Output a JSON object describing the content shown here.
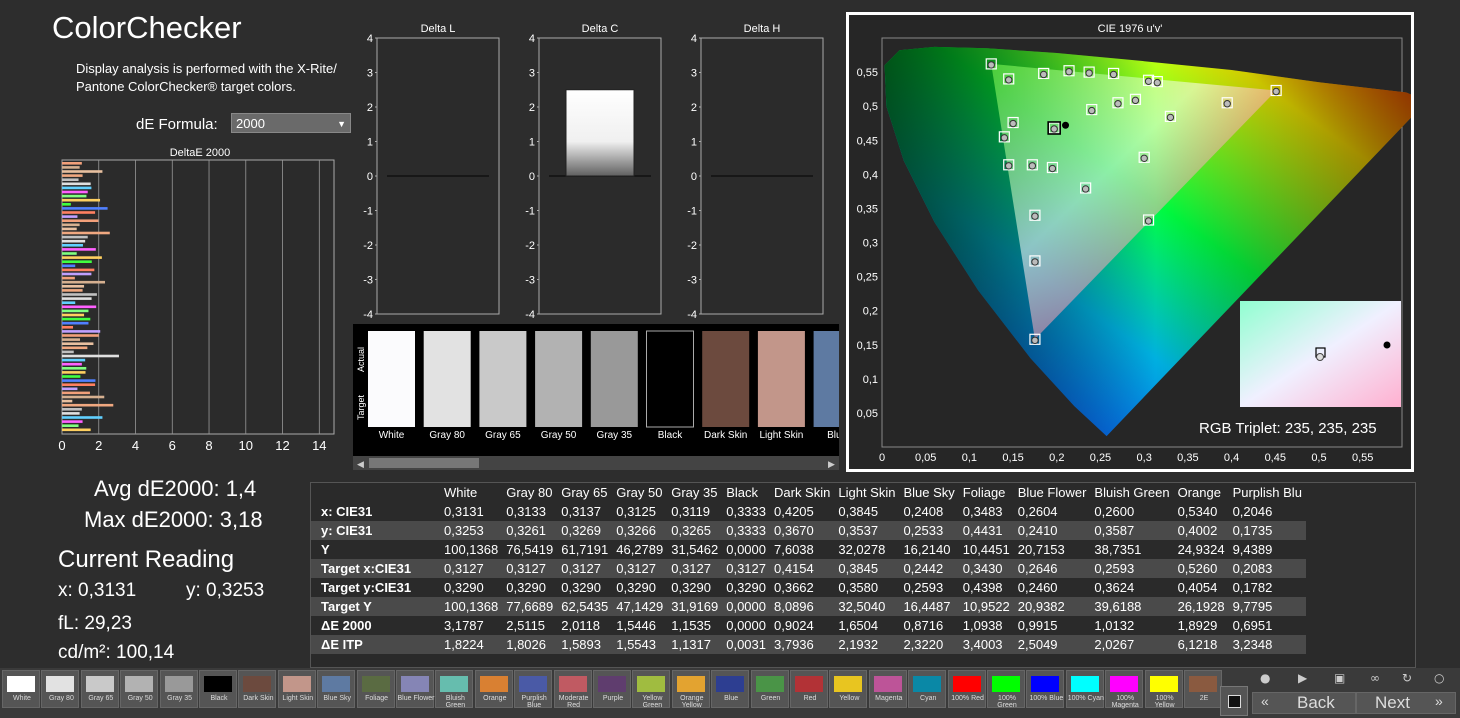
{
  "title": "ColorChecker",
  "description": "Display analysis is performed with the X-Rite/ Pantone ColorChecker® target colors.",
  "formula": {
    "label": "dE Formula:",
    "selected": "2000"
  },
  "deltae_chart": {
    "title": "DeltaE 2000",
    "xticks": [
      "0",
      "2",
      "4",
      "6",
      "8",
      "10",
      "12",
      "14"
    ]
  },
  "delta_charts": [
    {
      "title": "Delta L",
      "yticks": [
        "4",
        "3",
        "2",
        "1",
        "0",
        "-1",
        "-2",
        "-3",
        "-4"
      ],
      "value": 0
    },
    {
      "title": "Delta C",
      "yticks": [
        "4",
        "3",
        "2",
        "1",
        "0",
        "-1",
        "-2",
        "-3",
        "-4"
      ],
      "value": 2.5
    },
    {
      "title": "Delta H",
      "yticks": [
        "4",
        "3",
        "2",
        "1",
        "0",
        "-1",
        "-2",
        "-3",
        "-4"
      ],
      "value": 0
    }
  ],
  "swatch_strip": {
    "actual_label": "Actual",
    "target_label": "Target",
    "swatches": [
      {
        "name": "White",
        "actual": "#fbfbfd",
        "target": "#fbfbfd"
      },
      {
        "name": "Gray 80",
        "actual": "#e2e2e2",
        "target": "#e2e2e2"
      },
      {
        "name": "Gray 65",
        "actual": "#c9c9c9",
        "target": "#c9c9c9"
      },
      {
        "name": "Gray 50",
        "actual": "#b2b2b2",
        "target": "#b2b2b2"
      },
      {
        "name": "Gray 35",
        "actual": "#999999",
        "target": "#999999"
      },
      {
        "name": "Black",
        "actual": "#000000",
        "target": "#000000"
      },
      {
        "name": "Dark Skin",
        "actual": "#6c4a3e",
        "target": "#6c4a3e"
      },
      {
        "name": "Light Skin",
        "actual": "#c2968a",
        "target": "#c2968a"
      },
      {
        "name": "Blue",
        "actual": "#5e7aa2",
        "target": "#5e7aa2"
      }
    ]
  },
  "stats": {
    "avg": "Avg dE2000: 1,4",
    "max": "Max dE2000: 3,18"
  },
  "reading": {
    "title": "Current Reading",
    "x": "x: 0,3131",
    "y": "y: 0,3253",
    "fl": "fL: 29,23",
    "cd": "cd/m²: 100,14"
  },
  "table": {
    "columns": [
      "White",
      "Gray 80",
      "Gray 65",
      "Gray 50",
      "Gray 35",
      "Black",
      "Dark Skin",
      "Light Skin",
      "Blue Sky",
      "Foliage",
      "Blue Flower",
      "Bluish Green",
      "Orange",
      "Purplish Blu"
    ],
    "rows": [
      {
        "label": "x: CIE31",
        "values": [
          "0,3131",
          "0,3133",
          "0,3137",
          "0,3125",
          "0,3119",
          "0,3333",
          "0,4205",
          "0,3845",
          "0,2408",
          "0,3483",
          "0,2604",
          "0,2600",
          "0,5340",
          "0,2046"
        ]
      },
      {
        "label": "y: CIE31",
        "values": [
          "0,3253",
          "0,3261",
          "0,3269",
          "0,3266",
          "0,3265",
          "0,3333",
          "0,3670",
          "0,3537",
          "0,2533",
          "0,4431",
          "0,2410",
          "0,3587",
          "0,4002",
          "0,1735"
        ]
      },
      {
        "label": "Y",
        "values": [
          "100,1368",
          "76,5419",
          "61,7191",
          "46,2789",
          "31,5462",
          "0,0000",
          "7,6038",
          "32,0278",
          "16,2140",
          "10,4451",
          "20,7153",
          "38,7351",
          "24,9324",
          "9,4389"
        ]
      },
      {
        "label": "Target x:CIE31",
        "values": [
          "0,3127",
          "0,3127",
          "0,3127",
          "0,3127",
          "0,3127",
          "0,3127",
          "0,4154",
          "0,3845",
          "0,2442",
          "0,3430",
          "0,2646",
          "0,2593",
          "0,5260",
          "0,2083"
        ]
      },
      {
        "label": "Target y:CIE31",
        "values": [
          "0,3290",
          "0,3290",
          "0,3290",
          "0,3290",
          "0,3290",
          "0,3290",
          "0,3662",
          "0,3580",
          "0,2593",
          "0,4398",
          "0,2460",
          "0,3624",
          "0,4054",
          "0,1782"
        ]
      },
      {
        "label": "Target Y",
        "values": [
          "100,1368",
          "77,6689",
          "62,5435",
          "47,1429",
          "31,9169",
          "0,0000",
          "8,0896",
          "32,5040",
          "16,4487",
          "10,9522",
          "20,9382",
          "39,6188",
          "26,1928",
          "9,7795"
        ]
      },
      {
        "label": "ΔE 2000",
        "values": [
          "3,1787",
          "2,5115",
          "2,0118",
          "1,5446",
          "1,1535",
          "0,0000",
          "0,9024",
          "1,6504",
          "0,8716",
          "1,0938",
          "0,9915",
          "1,0132",
          "1,8929",
          "0,6951"
        ]
      },
      {
        "label": "ΔE ITP",
        "values": [
          "1,8224",
          "1,8026",
          "1,5893",
          "1,5543",
          "1,1317",
          "0,0031",
          "3,7936",
          "2,1932",
          "2,3220",
          "3,4003",
          "2,5049",
          "2,0267",
          "6,1218",
          "3,2348"
        ]
      }
    ]
  },
  "cie": {
    "title": "CIE 1976 u'v'",
    "xticks": [
      "0",
      "0,05",
      "0,1",
      "0,15",
      "0,2",
      "0,25",
      "0,3",
      "0,35",
      "0,4",
      "0,45",
      "0,5",
      "0,55"
    ],
    "yticks": [
      "0,55",
      "0,5",
      "0,45",
      "0,4",
      "0,35",
      "0,3",
      "0,25",
      "0,2",
      "0,15",
      "0,1",
      "0,05"
    ],
    "triplet": "RGB Triplet: 235, 235, 235"
  },
  "chips": [
    {
      "label": "White",
      "color": "#ffffff"
    },
    {
      "label": "Gray 80",
      "color": "#e2e2e2"
    },
    {
      "label": "Gray 65",
      "color": "#c9c9c9"
    },
    {
      "label": "Gray 50",
      "color": "#b2b2b2"
    },
    {
      "label": "Gray 35",
      "color": "#999999"
    },
    {
      "label": "Black",
      "color": "#000000"
    },
    {
      "label": "Dark Skin",
      "color": "#6c4a3e"
    },
    {
      "label": "Light Skin",
      "color": "#c2968a"
    },
    {
      "label": "Blue Sky",
      "color": "#5e7aa2"
    },
    {
      "label": "Foliage",
      "color": "#5a6b42"
    },
    {
      "label": "Blue Flower",
      "color": "#8585b5"
    },
    {
      "label": "Bluish Green",
      "color": "#66bdae"
    },
    {
      "label": "Orange",
      "color": "#d98032"
    },
    {
      "label": "Purplish Blue",
      "color": "#4a5aa6"
    },
    {
      "label": "Moderate Red",
      "color": "#c05a62"
    },
    {
      "label": "Purple",
      "color": "#5f3d6e"
    },
    {
      "label": "Yellow Green",
      "color": "#a0bc40"
    },
    {
      "label": "Orange Yellow",
      "color": "#e3a330"
    },
    {
      "label": "Blue",
      "color": "#2d3e91"
    },
    {
      "label": "Green",
      "color": "#4a9447"
    },
    {
      "label": "Red",
      "color": "#b23236"
    },
    {
      "label": "Yellow",
      "color": "#e8c520"
    },
    {
      "label": "Magenta",
      "color": "#bd5498"
    },
    {
      "label": "Cyan",
      "color": "#0a88a6"
    },
    {
      "label": "100% Red",
      "color": "#ff0000"
    },
    {
      "label": "100% Green",
      "color": "#00ff00"
    },
    {
      "label": "100% Blue",
      "color": "#0000ff"
    },
    {
      "label": "100% Cyan",
      "color": "#00ffff"
    },
    {
      "label": "100% Magenta",
      "color": "#ff00ff"
    },
    {
      "label": "100% Yellow",
      "color": "#ffff00"
    },
    {
      "label": "2E",
      "color": "#8a5a40"
    }
  ],
  "nav": {
    "back": "Back",
    "next": "Next"
  }
}
